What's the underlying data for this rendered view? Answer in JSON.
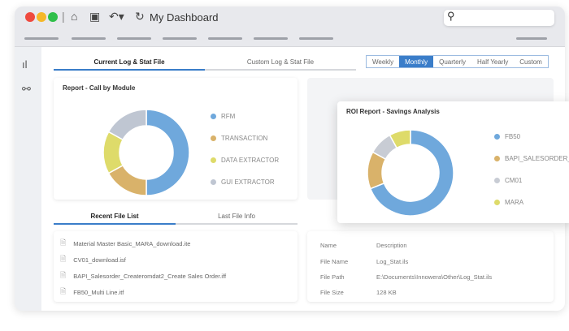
{
  "window": {
    "title": "My Dashboard",
    "traffic_colors": [
      "#ef4a3f",
      "#f5b829",
      "#2fbf4a"
    ]
  },
  "toolbar": {
    "icons": [
      "home-icon",
      "save-icon",
      "undo-icon",
      "refresh-icon"
    ],
    "search_placeholder": ""
  },
  "main_tabs": [
    {
      "label": "Current Log & Stat File",
      "active": true
    },
    {
      "label": "Custom Log & Stat File",
      "active": false
    }
  ],
  "periods": [
    {
      "label": "Weekly"
    },
    {
      "label": "Monthly",
      "active": true
    },
    {
      "label": "Quarterly"
    },
    {
      "label": "Half Yearly"
    },
    {
      "label": "Custom"
    }
  ],
  "chart_data": [
    {
      "type": "pie",
      "title": "Report - Call by Module",
      "categories": [
        "RFM",
        "TRANSACTION",
        "DATA EXTRACTOR",
        "GUI EXTRACTOR"
      ],
      "values": [
        50,
        17,
        16,
        17
      ],
      "colors": [
        "#6fa8dc",
        "#d9b26a",
        "#dedb6a",
        "#bfc6d2"
      ],
      "donut": true,
      "legend": "right"
    },
    {
      "type": "pie",
      "title": "ROI Report - Savings Analysis",
      "categories": [
        "FB50",
        "BAPI_SALESORDER_C...",
        "CM01",
        "MARA"
      ],
      "values": [
        69,
        14,
        9,
        8
      ],
      "colors": [
        "#6fa8dc",
        "#d9b26a",
        "#c8ccd4",
        "#dedb6a"
      ],
      "donut": true,
      "legend": "right"
    }
  ],
  "bottom_tabs": [
    {
      "label": "Recent File List",
      "active": true
    },
    {
      "label": "Last File Info",
      "active": false
    }
  ],
  "recent_files": [
    "Material Master Basic_MARA_download.ite",
    "CV01_download.isf",
    "BAPI_Salesorder_Createromdat2_Create Sales Order.iff",
    "FB50_Multi Line.itf"
  ],
  "file_info": {
    "headers": [
      "Name",
      "Description"
    ],
    "rows": [
      [
        "File Name",
        "Log_Stat.ils"
      ],
      [
        "File Path",
        "E:\\Documents\\Innowera\\Other\\Log_Stat.ils"
      ],
      [
        "File Size",
        "128 KB"
      ]
    ]
  }
}
